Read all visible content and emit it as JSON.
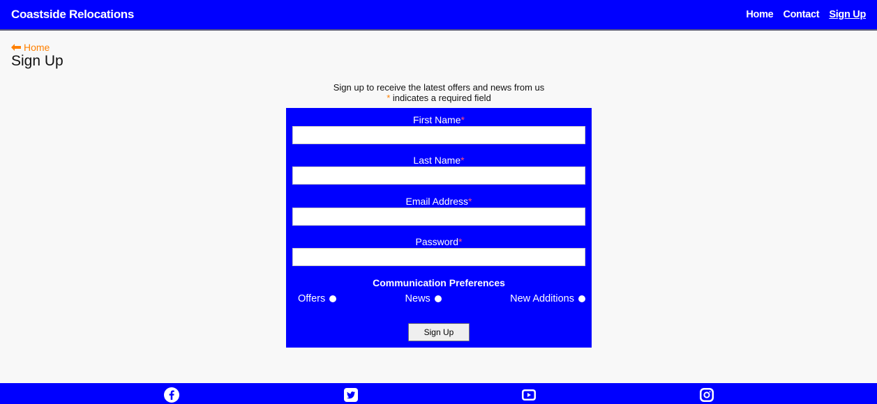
{
  "header": {
    "brand": "Coastside Relocations",
    "nav": [
      "Home",
      "Contact",
      "Sign Up"
    ]
  },
  "breadcrumb": {
    "back_label": "Home"
  },
  "page": {
    "title": "Sign Up"
  },
  "intro": {
    "line1": "Sign up to receive the latest offers and news from us",
    "star": "*",
    "line2": " indicates a required field"
  },
  "form": {
    "fields": [
      {
        "label": "First Name",
        "value": ""
      },
      {
        "label": "Last Name",
        "value": ""
      },
      {
        "label": "Email Address",
        "value": ""
      },
      {
        "label": "Password",
        "value": ""
      }
    ],
    "required_mark": "*",
    "prefs_title": "Communication Preferences",
    "prefs": [
      "Offers",
      "News",
      "New Additions"
    ],
    "submit_label": "Sign Up"
  },
  "footer": {
    "icons": [
      "facebook-icon",
      "twitter-icon",
      "youtube-icon",
      "instagram-icon"
    ]
  },
  "colors": {
    "primary": "#0000ff",
    "accent": "#ff8000"
  }
}
